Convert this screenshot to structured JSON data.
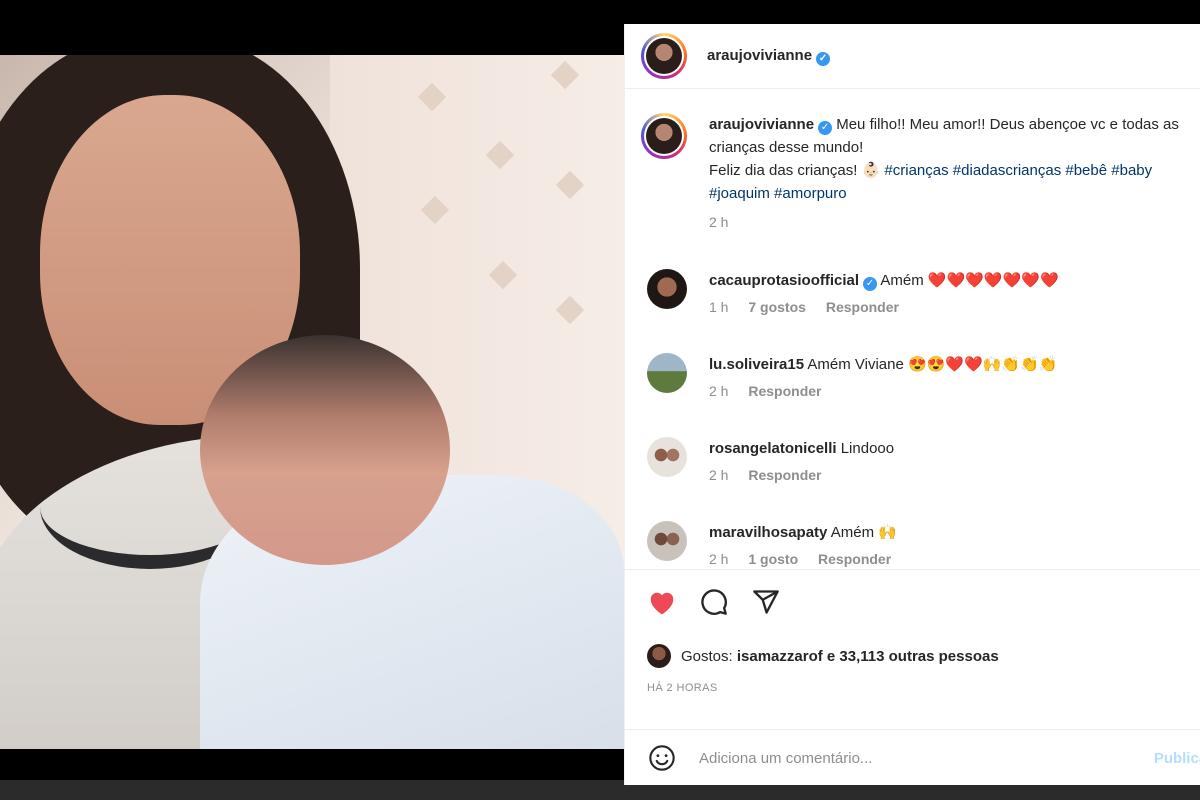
{
  "post": {
    "username": "araujovivianne",
    "verified_mark": "✓"
  },
  "caption": {
    "username": "araujovivianne",
    "text_line1": "Meu filho!! Meu amor!! Deus abençoe vc e todas as crianças desse mundo!",
    "text_line2": "Feliz dia das crianças! 👶🏻",
    "hashtags": [
      "#crianças",
      "#diadascrianças",
      "#bebê",
      "#baby",
      "#joaquim",
      "#amorpuro"
    ],
    "time": "2 h"
  },
  "comments": [
    {
      "username": "cacauprotasioofficial",
      "verified": true,
      "text": "Amém ❤️❤️❤️❤️❤️❤️❤️",
      "time": "1 h",
      "likes": "7 gostos",
      "reply": "Responder"
    },
    {
      "username": "lu.soliveira15",
      "verified": false,
      "text": "Amém Viviane 😍😍❤️❤️🙌👏👏👏",
      "time": "2 h",
      "likes": "",
      "reply": "Responder"
    },
    {
      "username": "rosangelatonicelli",
      "verified": false,
      "text": "Lindooo",
      "time": "2 h",
      "likes": "",
      "reply": "Responder"
    },
    {
      "username": "maravilhosapaty",
      "verified": false,
      "text": "Amém 🙌",
      "time": "2 h",
      "likes": "1 gosto",
      "reply": "Responder"
    }
  ],
  "actions": {
    "liked": true,
    "like_color": "#ed4956",
    "likes_prefix": "Gostos:",
    "likes_user": "isamazzarof",
    "likes_rest": "e 33,113 outras pessoas",
    "posted_ago": "HÁ 2 HORAS"
  },
  "add_comment": {
    "placeholder": "Adiciona um comentário...",
    "publish_label": "Publicar"
  }
}
